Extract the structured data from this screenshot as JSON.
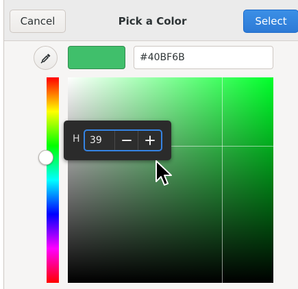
{
  "header": {
    "title": "Pick a Color",
    "cancel_label": "Cancel",
    "select_label": "Select"
  },
  "editor": {
    "color_hex": "#40BF6B",
    "hex_entry_value": "#40BF6B",
    "eyedropper_icon": "eyedropper-icon",
    "hue": {
      "label": "H",
      "value": "39",
      "minus_icon": "minus-icon",
      "plus_icon": "plus-icon"
    }
  },
  "colors": {
    "accent": "#3584e4",
    "plane_hue": "#00ff2a",
    "swatch": "#40BF6B"
  },
  "pointer": {
    "icon": "mouse-pointer-icon"
  }
}
